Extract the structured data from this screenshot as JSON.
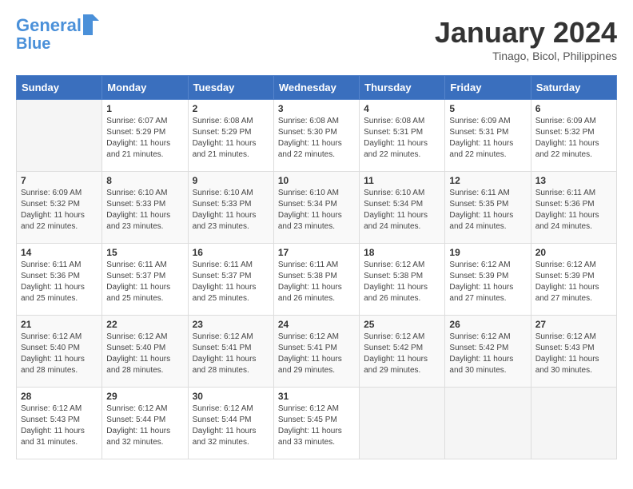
{
  "header": {
    "logo_line1": "General",
    "logo_line2": "Blue",
    "title": "January 2024",
    "subtitle": "Tinago, Bicol, Philippines"
  },
  "weekdays": [
    "Sunday",
    "Monday",
    "Tuesday",
    "Wednesday",
    "Thursday",
    "Friday",
    "Saturday"
  ],
  "weeks": [
    [
      {
        "day": "",
        "sunrise": "",
        "sunset": "",
        "daylight": ""
      },
      {
        "day": "1",
        "sunrise": "Sunrise: 6:07 AM",
        "sunset": "Sunset: 5:29 PM",
        "daylight": "Daylight: 11 hours and 21 minutes."
      },
      {
        "day": "2",
        "sunrise": "Sunrise: 6:08 AM",
        "sunset": "Sunset: 5:29 PM",
        "daylight": "Daylight: 11 hours and 21 minutes."
      },
      {
        "day": "3",
        "sunrise": "Sunrise: 6:08 AM",
        "sunset": "Sunset: 5:30 PM",
        "daylight": "Daylight: 11 hours and 22 minutes."
      },
      {
        "day": "4",
        "sunrise": "Sunrise: 6:08 AM",
        "sunset": "Sunset: 5:31 PM",
        "daylight": "Daylight: 11 hours and 22 minutes."
      },
      {
        "day": "5",
        "sunrise": "Sunrise: 6:09 AM",
        "sunset": "Sunset: 5:31 PM",
        "daylight": "Daylight: 11 hours and 22 minutes."
      },
      {
        "day": "6",
        "sunrise": "Sunrise: 6:09 AM",
        "sunset": "Sunset: 5:32 PM",
        "daylight": "Daylight: 11 hours and 22 minutes."
      }
    ],
    [
      {
        "day": "7",
        "sunrise": "Sunrise: 6:09 AM",
        "sunset": "Sunset: 5:32 PM",
        "daylight": "Daylight: 11 hours and 22 minutes."
      },
      {
        "day": "8",
        "sunrise": "Sunrise: 6:10 AM",
        "sunset": "Sunset: 5:33 PM",
        "daylight": "Daylight: 11 hours and 23 minutes."
      },
      {
        "day": "9",
        "sunrise": "Sunrise: 6:10 AM",
        "sunset": "Sunset: 5:33 PM",
        "daylight": "Daylight: 11 hours and 23 minutes."
      },
      {
        "day": "10",
        "sunrise": "Sunrise: 6:10 AM",
        "sunset": "Sunset: 5:34 PM",
        "daylight": "Daylight: 11 hours and 23 minutes."
      },
      {
        "day": "11",
        "sunrise": "Sunrise: 6:10 AM",
        "sunset": "Sunset: 5:34 PM",
        "daylight": "Daylight: 11 hours and 24 minutes."
      },
      {
        "day": "12",
        "sunrise": "Sunrise: 6:11 AM",
        "sunset": "Sunset: 5:35 PM",
        "daylight": "Daylight: 11 hours and 24 minutes."
      },
      {
        "day": "13",
        "sunrise": "Sunrise: 6:11 AM",
        "sunset": "Sunset: 5:36 PM",
        "daylight": "Daylight: 11 hours and 24 minutes."
      }
    ],
    [
      {
        "day": "14",
        "sunrise": "Sunrise: 6:11 AM",
        "sunset": "Sunset: 5:36 PM",
        "daylight": "Daylight: 11 hours and 25 minutes."
      },
      {
        "day": "15",
        "sunrise": "Sunrise: 6:11 AM",
        "sunset": "Sunset: 5:37 PM",
        "daylight": "Daylight: 11 hours and 25 minutes."
      },
      {
        "day": "16",
        "sunrise": "Sunrise: 6:11 AM",
        "sunset": "Sunset: 5:37 PM",
        "daylight": "Daylight: 11 hours and 25 minutes."
      },
      {
        "day": "17",
        "sunrise": "Sunrise: 6:11 AM",
        "sunset": "Sunset: 5:38 PM",
        "daylight": "Daylight: 11 hours and 26 minutes."
      },
      {
        "day": "18",
        "sunrise": "Sunrise: 6:12 AM",
        "sunset": "Sunset: 5:38 PM",
        "daylight": "Daylight: 11 hours and 26 minutes."
      },
      {
        "day": "19",
        "sunrise": "Sunrise: 6:12 AM",
        "sunset": "Sunset: 5:39 PM",
        "daylight": "Daylight: 11 hours and 27 minutes."
      },
      {
        "day": "20",
        "sunrise": "Sunrise: 6:12 AM",
        "sunset": "Sunset: 5:39 PM",
        "daylight": "Daylight: 11 hours and 27 minutes."
      }
    ],
    [
      {
        "day": "21",
        "sunrise": "Sunrise: 6:12 AM",
        "sunset": "Sunset: 5:40 PM",
        "daylight": "Daylight: 11 hours and 28 minutes."
      },
      {
        "day": "22",
        "sunrise": "Sunrise: 6:12 AM",
        "sunset": "Sunset: 5:40 PM",
        "daylight": "Daylight: 11 hours and 28 minutes."
      },
      {
        "day": "23",
        "sunrise": "Sunrise: 6:12 AM",
        "sunset": "Sunset: 5:41 PM",
        "daylight": "Daylight: 11 hours and 28 minutes."
      },
      {
        "day": "24",
        "sunrise": "Sunrise: 6:12 AM",
        "sunset": "Sunset: 5:41 PM",
        "daylight": "Daylight: 11 hours and 29 minutes."
      },
      {
        "day": "25",
        "sunrise": "Sunrise: 6:12 AM",
        "sunset": "Sunset: 5:42 PM",
        "daylight": "Daylight: 11 hours and 29 minutes."
      },
      {
        "day": "26",
        "sunrise": "Sunrise: 6:12 AM",
        "sunset": "Sunset: 5:42 PM",
        "daylight": "Daylight: 11 hours and 30 minutes."
      },
      {
        "day": "27",
        "sunrise": "Sunrise: 6:12 AM",
        "sunset": "Sunset: 5:43 PM",
        "daylight": "Daylight: 11 hours and 30 minutes."
      }
    ],
    [
      {
        "day": "28",
        "sunrise": "Sunrise: 6:12 AM",
        "sunset": "Sunset: 5:43 PM",
        "daylight": "Daylight: 11 hours and 31 minutes."
      },
      {
        "day": "29",
        "sunrise": "Sunrise: 6:12 AM",
        "sunset": "Sunset: 5:44 PM",
        "daylight": "Daylight: 11 hours and 32 minutes."
      },
      {
        "day": "30",
        "sunrise": "Sunrise: 6:12 AM",
        "sunset": "Sunset: 5:44 PM",
        "daylight": "Daylight: 11 hours and 32 minutes."
      },
      {
        "day": "31",
        "sunrise": "Sunrise: 6:12 AM",
        "sunset": "Sunset: 5:45 PM",
        "daylight": "Daylight: 11 hours and 33 minutes."
      },
      {
        "day": "",
        "sunrise": "",
        "sunset": "",
        "daylight": ""
      },
      {
        "day": "",
        "sunrise": "",
        "sunset": "",
        "daylight": ""
      },
      {
        "day": "",
        "sunrise": "",
        "sunset": "",
        "daylight": ""
      }
    ]
  ]
}
